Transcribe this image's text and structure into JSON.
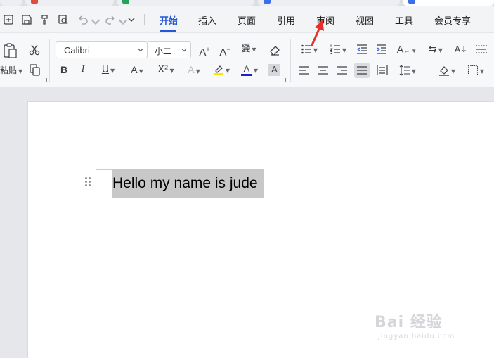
{
  "menu": {
    "items": [
      {
        "label": "开始",
        "active": true
      },
      {
        "label": "插入"
      },
      {
        "label": "页面"
      },
      {
        "label": "引用"
      },
      {
        "label": "审阅"
      },
      {
        "label": "视图"
      },
      {
        "label": "工具"
      },
      {
        "label": "会员专享"
      }
    ]
  },
  "ribbon": {
    "paste_label": "粘贴",
    "font_name": "Calibri",
    "font_size": "小二",
    "bold": "B",
    "italic": "I",
    "underline": "U",
    "superscript": "X²",
    "clear_style": "A",
    "highlight_color": "#ffe600",
    "font_color": "#2020c8"
  },
  "document": {
    "text": "Hello my name is jude"
  },
  "colors": {
    "accent": "#2458d6",
    "annotation_arrow": "#e8302a"
  },
  "watermark": {
    "logo": "Bai 经验",
    "url": "jingyan.baidu.com"
  }
}
